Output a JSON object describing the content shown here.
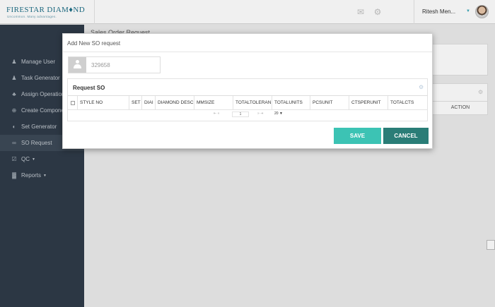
{
  "header": {
    "logo_main": "FIRESTAR DIAM♦ND",
    "logo_sub": "Uncommon. Many advantages.",
    "user_name": "Ritesh Men...",
    "icons": [
      "mail-icon",
      "gear-icon"
    ]
  },
  "sidebar": {
    "items": [
      {
        "label": "Manage User",
        "icon": "user-icon",
        "glyph": "♟"
      },
      {
        "label": "Task Generator",
        "icon": "person-icon",
        "glyph": "♟"
      },
      {
        "label": "Assign Operations",
        "icon": "users-icon",
        "glyph": "♣"
      },
      {
        "label": "Create Components",
        "icon": "plus-circle-icon",
        "glyph": "⊕"
      },
      {
        "label": "Set Generator",
        "icon": "dial-icon",
        "glyph": "◐"
      },
      {
        "label": "SO Request",
        "icon": "link-icon",
        "glyph": "∞"
      },
      {
        "label": "QC",
        "icon": "check-shield-icon",
        "glyph": "☑"
      },
      {
        "label": "Reports",
        "icon": "chart-icon",
        "glyph": "▓"
      }
    ]
  },
  "page": {
    "title": "Sales Order Request",
    "action_header": "ACTION"
  },
  "modal": {
    "title": "Add New SO request",
    "so_number": "329658",
    "panel_title": "Request SO",
    "columns": [
      "STYLE NO",
      "SET",
      "DIAI",
      "DIAMOND DESC",
      "MMSIZE",
      "TOTALTOLERAN",
      "TOTALUNITS",
      "PCSUNIT",
      "CTSPERUNIT",
      "TOTALCTS"
    ],
    "pager": {
      "page": "1",
      "page_size": "20 ▼",
      "first_prev": "⇤ «",
      "next_last": "» ⇥"
    },
    "save_label": "SAVE",
    "cancel_label": "CANCEL"
  }
}
